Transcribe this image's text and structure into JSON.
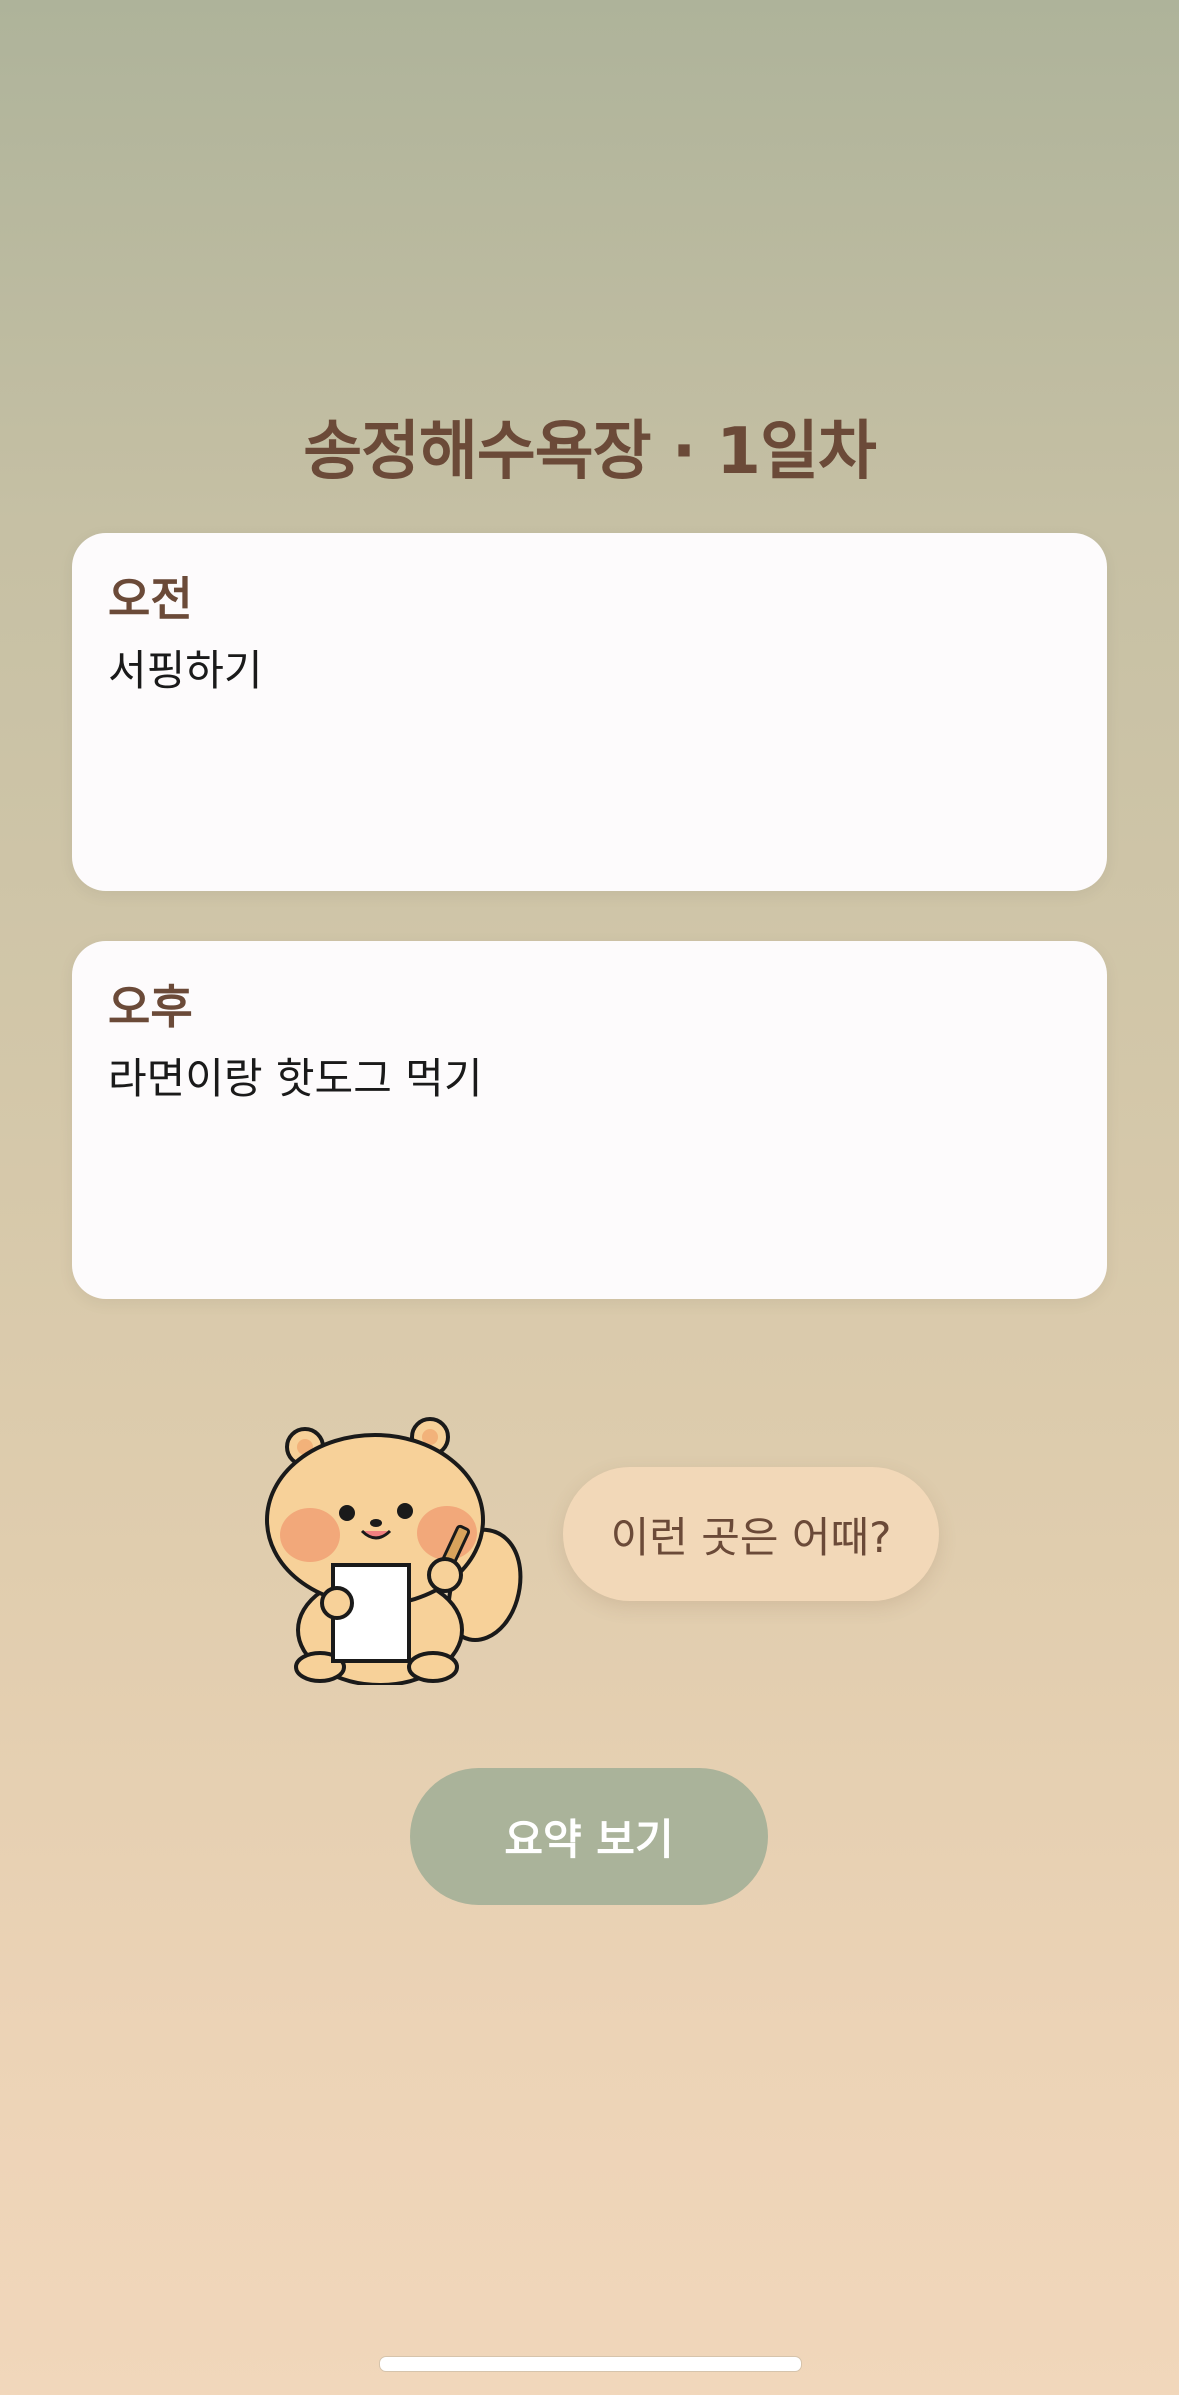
{
  "header": {
    "title": "송정해수욕장 · 1일차"
  },
  "schedule": {
    "morning": {
      "label": "오전",
      "content": "서핑하기"
    },
    "afternoon": {
      "label": "오후",
      "content": "라면이랑 핫도그 먹기"
    }
  },
  "suggestion": {
    "bubble_text": "이런 곳은 어때?"
  },
  "actions": {
    "summary_label": "요약 보기"
  },
  "mascot": {
    "icon": "squirrel-with-memo-icon"
  },
  "colors": {
    "title": "#6b4a38",
    "card_bg": "#fdfbfc",
    "bubble_bg": "#f2d8b8",
    "button_bg": "#aab39a",
    "bg_top": "#aeb39a",
    "bg_bottom": "#f1d7bb"
  }
}
